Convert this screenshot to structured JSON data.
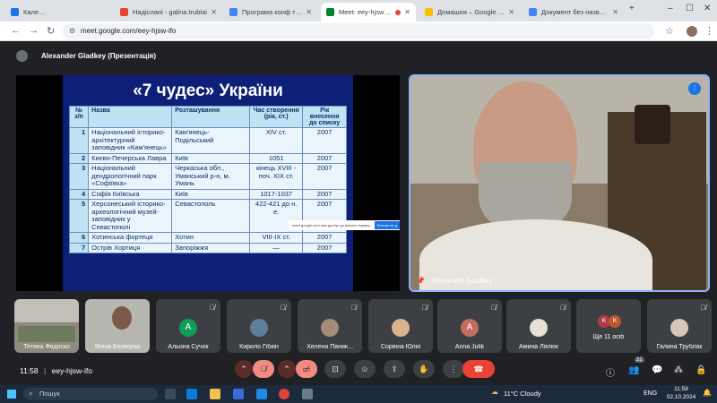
{
  "tabs": [
    {
      "label": "Календар Google - верес",
      "color": "#1a73e8"
    },
    {
      "label": "Надіслані - galina.trublai",
      "color": "#ea4335"
    },
    {
      "label": "Програма конф туризм Л",
      "color": "#4285f4"
    },
    {
      "label": "Meet: eey-hjsw-ifo",
      "color": "#00832d",
      "active": true
    },
    {
      "label": "Домашня – Google Диск",
      "color": "#fbbc04"
    },
    {
      "label": "Документ без назви - Go",
      "color": "#4285f4"
    }
  ],
  "toolbar": {
    "url": "meet.google.com/eey-hjsw-ifo"
  },
  "presenter_banner": "Alexander Gladkey (Презентація)",
  "slide": {
    "title": "«7 чудес» України",
    "headers": [
      "№ з/п",
      "Назва",
      "Розташування",
      "Час створення (рік, ст.)",
      "Рік внесення до списку"
    ],
    "rows": [
      {
        "n": "1",
        "name": "Національний історико-архітектурний заповідник «Кам'янець»",
        "place": "Кам'янець-Подільський",
        "time": "XIV ст.",
        "year": "2007"
      },
      {
        "n": "2",
        "name": "Києво-Печерська Лавра",
        "place": "Київ",
        "time": "1051",
        "year": "2007"
      },
      {
        "n": "3",
        "name": "Національний дендрологічний парк «Софіївка»",
        "place": "Черкаська обл., Уманський р-н, м. Умань",
        "time": "кінець XVIII - поч. XIX ст.",
        "year": "2007"
      },
      {
        "n": "4",
        "name": "Софія Київська",
        "place": "Київ",
        "time": "1017-1037",
        "year": "2007"
      },
      {
        "n": "5",
        "name": "Херсонеський історико-археологічний музей-заповідник у Севастополі",
        "place": "Севастополь",
        "time": "422-421 до н. е.",
        "year": "2007"
      },
      {
        "n": "6",
        "name": "Хотинська фортеця",
        "place": "Хотин",
        "time": "VIII-IX ст.",
        "year": "2007"
      },
      {
        "n": "7",
        "name": "Острів Хортиця",
        "place": "Запоріжжя",
        "time": "—",
        "year": "2007"
      }
    ],
    "tooltip_text": "meet.google.com має доступ до вашого екрана.",
    "tooltip_button": "Більше не д"
  },
  "speaker": {
    "name": "Alexander Gladkey"
  },
  "participants": [
    {
      "name": "Тетяна Федоско",
      "kind": "video"
    },
    {
      "name": "Яніна Безверха",
      "kind": "video"
    },
    {
      "name": "Альона Сучок",
      "kind": "letter",
      "letter": "A",
      "color": "#0f9d58"
    },
    {
      "name": "Кирило Гібкін",
      "kind": "photo"
    },
    {
      "name": "Хелена Паник...",
      "kind": "photo"
    },
    {
      "name": "Сорвіна Юлія",
      "kind": "photo"
    },
    {
      "name": "Anna Julik",
      "kind": "letter",
      "letter": "A",
      "color": "#c26e5e"
    },
    {
      "name": "Амина Лялюк",
      "kind": "photo"
    },
    {
      "name": "Ще 11 осіб",
      "kind": "more",
      "letters": [
        "K",
        "K"
      ]
    },
    {
      "name": "Галина Трублак",
      "kind": "photo"
    }
  ],
  "footer": {
    "time": "11:58",
    "separator": "|",
    "code": "eey-hjsw-ifo",
    "people_count": "22"
  },
  "taskbar": {
    "search": "Пошук",
    "weather": "11°C  Cloudy",
    "lang": "ENG",
    "clock_time": "11:58",
    "clock_date": "02.10.2024"
  }
}
